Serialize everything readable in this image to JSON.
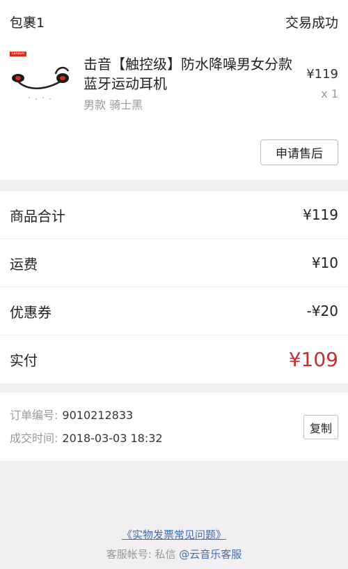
{
  "package": {
    "title": "包裹1",
    "status": "交易成功",
    "item": {
      "brand": "Lenovo",
      "title": "击音【触控级】防水降噪男女分款蓝牙运动耳机",
      "spec": "男款 骑士黑",
      "price": "¥119",
      "quantity": "x 1"
    },
    "after_sale_label": "申请售后"
  },
  "summary": {
    "rows": [
      {
        "label": "商品合计",
        "value": "¥119"
      },
      {
        "label": "运费",
        "value": "¥10"
      },
      {
        "label": "优惠券",
        "value": "-¥20"
      },
      {
        "label": "实付",
        "value": "¥109"
      }
    ],
    "paid_color": "#c62f2f"
  },
  "order": {
    "number_label": "订单编号:",
    "number": "9010212833",
    "time_label": "成交时间:",
    "time": "2018-03-03 18:32",
    "copy_label": "复制"
  },
  "footer": {
    "faq_link": "《实物发票常见问题》",
    "service_label": "客服帐号: 私信",
    "service_link": "@云音乐客服"
  }
}
